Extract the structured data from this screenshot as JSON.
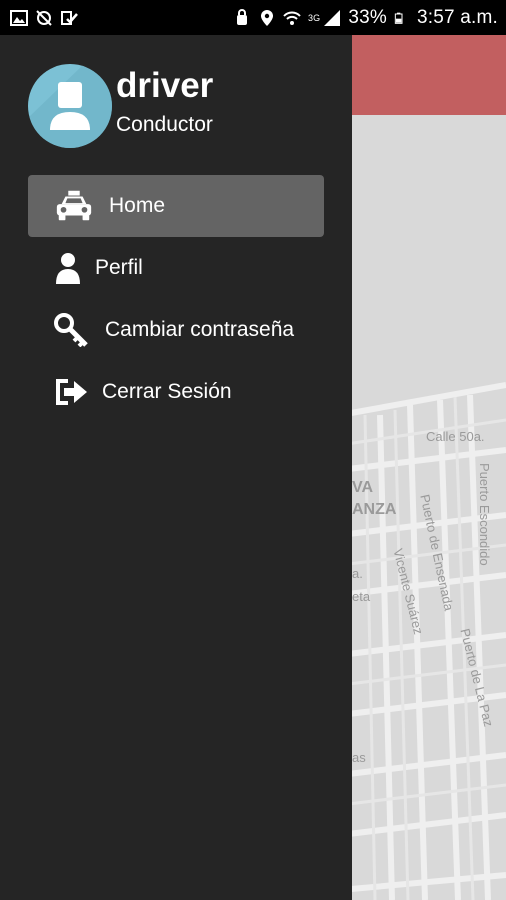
{
  "status_bar": {
    "battery": "33%",
    "time": "3:57 a.m.",
    "icons_left": [
      "image-icon",
      "sync-off-icon",
      "check-mail-icon"
    ],
    "icons_right": [
      "alarm-lock-icon",
      "location-icon",
      "wifi-icon",
      "signal-icon",
      "battery-icon"
    ],
    "network": "3G"
  },
  "drawer": {
    "user_name": "driver",
    "user_role": "Conductor",
    "menu": [
      {
        "label": "Home",
        "icon": "taxi-icon",
        "active": true
      },
      {
        "label": "Perfil",
        "icon": "person-icon",
        "active": false
      },
      {
        "label": "Cambiar contraseña",
        "icon": "key-icon",
        "active": false
      },
      {
        "label": "Cerrar Sesión",
        "icon": "logout-icon",
        "active": false
      }
    ]
  },
  "map": {
    "labels": [
      "Calle 50a.",
      "Puerto Escondido",
      "VA",
      "ANZA",
      "Puerto de Ensenada",
      "Vicente Suárez",
      "Puerto de La Paz",
      "a.",
      "eta",
      "as"
    ]
  },
  "colors": {
    "drawer_bg": "#252525",
    "active_item_bg": "#646464",
    "toolbar_accent": "#c25f60",
    "avatar_bg": "#7cc1d5",
    "map_bg": "#d9d9d9"
  }
}
